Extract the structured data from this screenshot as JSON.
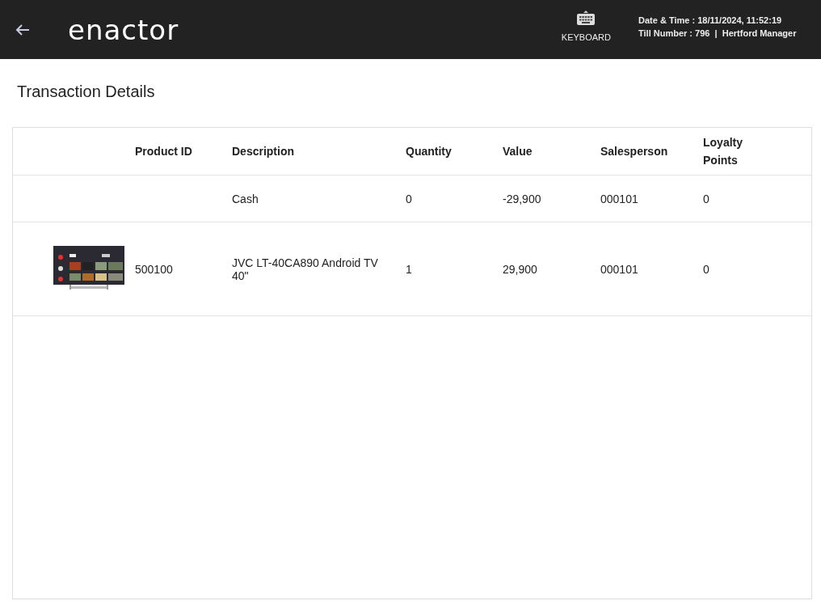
{
  "header": {
    "logo": "enactor",
    "keyboard_label": "KEYBOARD",
    "date_time": "Date & Time : 18/11/2024, 11:52:19",
    "till_info": "Till Number : 796  |  Hertford Manager"
  },
  "page_title": "Transaction Details",
  "table": {
    "columns": [
      "",
      "Product ID",
      "Description",
      "Quantity",
      "Value",
      "Salesperson",
      "Loyalty Points"
    ],
    "rows": [
      {
        "kind": "tender",
        "product_id": "",
        "description": "Cash",
        "quantity": "0",
        "value": "-29,900",
        "salesperson": "000101",
        "loyalty_points": "0"
      },
      {
        "kind": "product",
        "product_id": "500100",
        "description": "JVC LT-40CA890 Android TV 40\"",
        "quantity": "1",
        "value": "29,900",
        "salesperson": "000101",
        "loyalty_points": "0"
      }
    ]
  }
}
